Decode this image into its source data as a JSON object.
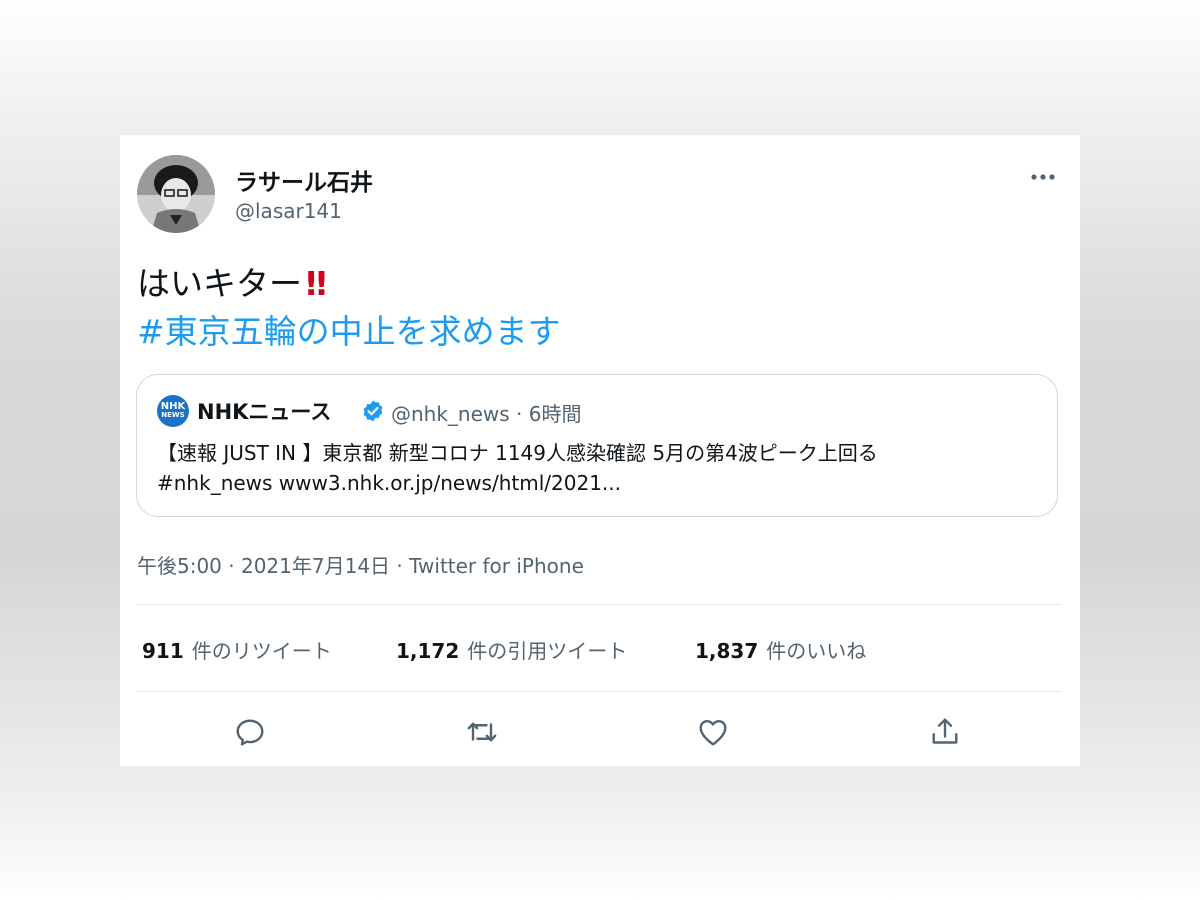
{
  "tweet": {
    "display_name": "ラサール石井",
    "handle": "@lasar141",
    "more_icon": "more-horizontal-icon",
    "text": "はいキター",
    "emoji": "‼",
    "hashtag": "#東京五輪の中止を求めます",
    "quoted": {
      "logo_text_top": "NHK",
      "logo_text_bottom": "NEWS",
      "name": "NHKニュース",
      "verified_icon": "verified-badge-icon",
      "meta": "@nhk_news · 6時間",
      "text": "【速報 JUST IN 】東京都 新型コロナ 1149人感染確認 5月の第4波ピーク上回る",
      "link_line": "#nhk_news www3.nhk.or.jp/news/html/2021..."
    },
    "timestamp": "午後5:00 · 2021年7月14日 · Twitter for iPhone",
    "stats": {
      "retweets_count": "911",
      "retweets_label": "件のリツイート",
      "quotes_count": "1,172",
      "quotes_label": "件の引用ツイート",
      "likes_count": "1,837",
      "likes_label": "件のいいね"
    },
    "actions": [
      "reply-icon",
      "retweet-icon",
      "like-icon",
      "share-icon"
    ]
  },
  "colors": {
    "link": "#1d9bf0",
    "muted": "#536471",
    "text": "#0f1419",
    "verified": "#1d9bf0",
    "nhk_blue": "#1a73c8"
  }
}
